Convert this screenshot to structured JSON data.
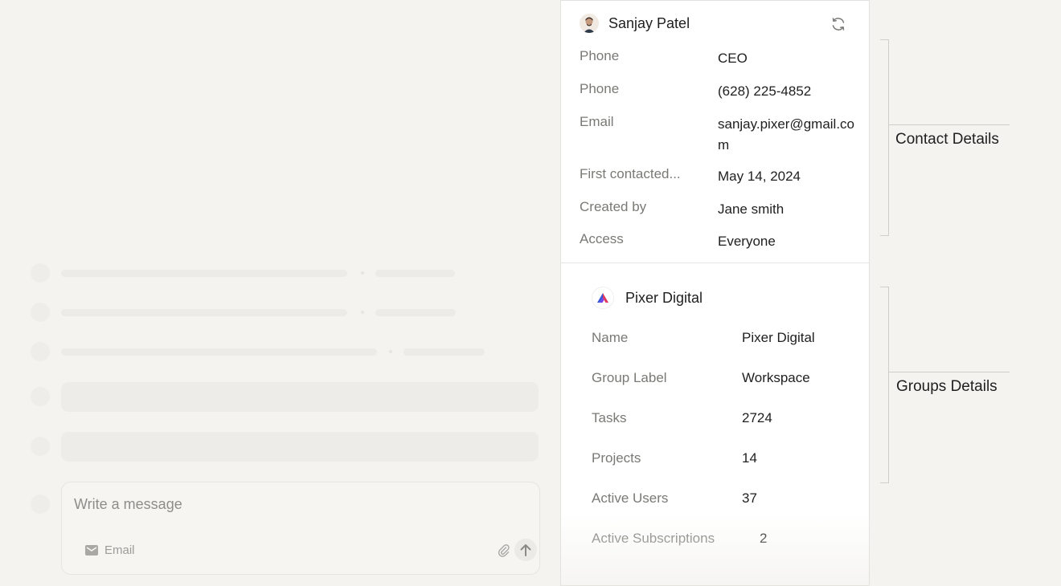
{
  "composer": {
    "placeholder": "Write a message",
    "channel_label": "Email",
    "icons": [
      "mail-icon",
      "paperclip-icon",
      "arrow-up-icon"
    ]
  },
  "contact": {
    "name": "Sanjay Patel",
    "fields": [
      {
        "label": "Phone",
        "value": "CEO"
      },
      {
        "label": "Phone",
        "value": "(628) 225-4852"
      },
      {
        "label": "Email",
        "value": "sanjay.pixer@gmail.com"
      },
      {
        "label": "First contacted...",
        "value": "May 14, 2024"
      },
      {
        "label": "Created by",
        "value": "Jane smith"
      },
      {
        "label": "Access",
        "value": "Everyone"
      }
    ]
  },
  "group": {
    "name": "Pixer Digital",
    "fields": [
      {
        "label": "Name",
        "value": "Pixer Digital"
      },
      {
        "label": "Group Label",
        "value": "Workspace"
      },
      {
        "label": "Tasks",
        "value": "2724"
      },
      {
        "label": "Projects",
        "value": "14"
      },
      {
        "label": "Active Users",
        "value": "37"
      },
      {
        "label": "Active Subscriptions",
        "value": "2"
      }
    ]
  },
  "annotations": {
    "contact": "Contact Details",
    "groups": "Groups Details"
  }
}
